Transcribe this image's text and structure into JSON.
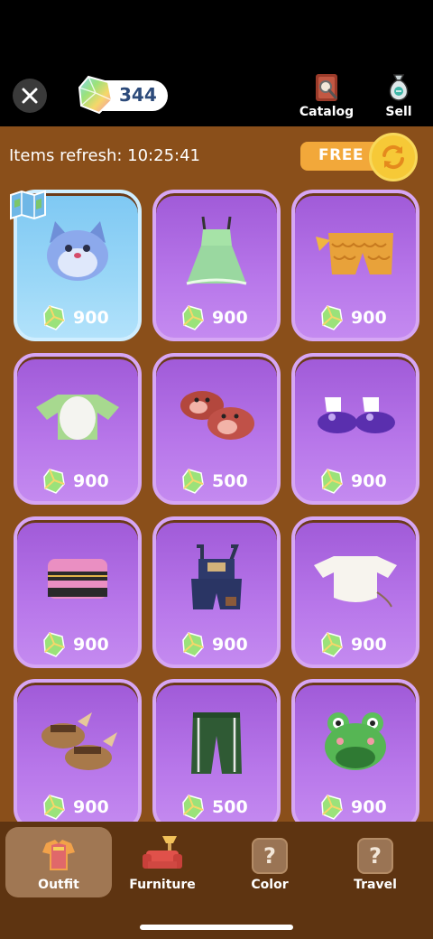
{
  "header": {
    "close_icon": "close-icon",
    "currency": {
      "icon": "gem-icon",
      "amount": "344"
    },
    "actions": [
      {
        "label": "Catalog",
        "icon": "catalog-book-icon"
      },
      {
        "label": "Sell",
        "icon": "money-bag-icon"
      }
    ]
  },
  "refresh": {
    "label": "Items refresh: 10:25:41",
    "free_label": "FREE",
    "refresh_icon": "refresh-arrows-icon"
  },
  "items": [
    {
      "name": "Blue Wolf Hat",
      "icon": "wolf-hat-icon",
      "price": "900",
      "selected": true,
      "badge": "map-icon"
    },
    {
      "name": "Green Sundress",
      "icon": "dress-icon",
      "price": "900"
    },
    {
      "name": "Fish Scale Shorts",
      "icon": "scale-shorts-icon",
      "price": "900"
    },
    {
      "name": "Green Sleeve Top",
      "icon": "shirt-icon",
      "price": "900"
    },
    {
      "name": "Cow Slippers",
      "icon": "cow-slippers-icon",
      "price": "500"
    },
    {
      "name": "Purple Shoes",
      "icon": "shoes-icon",
      "price": "900"
    },
    {
      "name": "Striped Hat",
      "icon": "striped-hat-icon",
      "price": "900"
    },
    {
      "name": "Denim Overalls",
      "icon": "overalls-icon",
      "price": "900"
    },
    {
      "name": "White Top",
      "icon": "white-top-icon",
      "price": "900"
    },
    {
      "name": "Winged Sandals",
      "icon": "sandals-icon",
      "price": "900"
    },
    {
      "name": "Green Track Pants",
      "icon": "pants-icon",
      "price": "500"
    },
    {
      "name": "Frog Hat",
      "icon": "frog-hat-icon",
      "price": "900"
    }
  ],
  "nav": [
    {
      "label": "Outfit",
      "icon": "outfit-icon",
      "active": true
    },
    {
      "label": "Furniture",
      "icon": "sofa-icon",
      "active": false
    },
    {
      "label": "Color",
      "icon": "question-icon",
      "active": false
    },
    {
      "label": "Travel",
      "icon": "question-icon",
      "active": false
    }
  ],
  "colors": {
    "background": "#8a4f1a",
    "card_purple": "#b877ea",
    "card_selected": "#9ad7f7",
    "free_pill": "#f2a83a",
    "refresh_button": "#f6c937",
    "nav_bar": "#5e3411"
  }
}
